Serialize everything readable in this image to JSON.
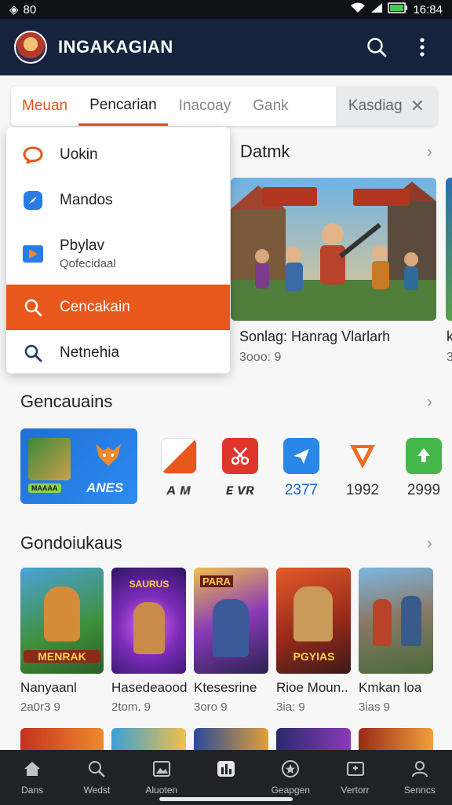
{
  "status": {
    "left": "80",
    "time": "16:84"
  },
  "app": {
    "title": "INGAKAGIAN"
  },
  "tabs": [
    {
      "label": "Meuan"
    },
    {
      "label": "Pencarian"
    },
    {
      "label": "Inacoay"
    },
    {
      "label": "Gank"
    },
    {
      "label": "Kasdiag"
    }
  ],
  "dropdown": [
    {
      "label": "Uokin",
      "icon": "chat-bubble-icon"
    },
    {
      "label": "Mandos",
      "icon": "compass-icon"
    },
    {
      "label": "Pbylav",
      "sub": "Qofecidaal",
      "icon": "play-icon"
    },
    {
      "label": "Cencakain",
      "icon": "search-icon"
    },
    {
      "label": "Netnehia",
      "icon": "search-icon"
    }
  ],
  "featured": {
    "section": "Datmk",
    "title": "Sonlag: Hanrag Vlarlarh",
    "meta": "3ooo: 9",
    "peek_title": "k",
    "peek_meta": "3"
  },
  "categories": {
    "section": "Gencauains",
    "banner_label": "ANES",
    "banner_sign": "MAAAA",
    "items": [
      {
        "label": "ᴀ ᴍ",
        "color": "#333333"
      },
      {
        "label": "ᴇ ᴠʀ",
        "color": "#333333"
      },
      {
        "label": "2377",
        "color": "#1f66c9"
      },
      {
        "label": "1992",
        "color": "#333333"
      },
      {
        "label": "2999",
        "color": "#333333"
      }
    ]
  },
  "games": {
    "section": "Gondoiukaus",
    "items": [
      {
        "name": "Nanyaanl",
        "meta": "2a0r3 9",
        "cover_text": "MENRAK"
      },
      {
        "name": "Hasedeaood",
        "meta": "2tom. 9",
        "cover_text": "SAURUS"
      },
      {
        "name": "Ktesesrine",
        "meta": "3oro 9",
        "cover_text": "PARA"
      },
      {
        "name": "Rioe Moun..",
        "meta": "3ia: 9",
        "cover_text": "PGYIAS"
      },
      {
        "name": "Kmkan loa",
        "meta": "3ias 9",
        "cover_text": ""
      }
    ]
  },
  "nav": [
    {
      "label": "Dans",
      "icon": "home-icon"
    },
    {
      "label": "Wedst",
      "icon": "search-icon"
    },
    {
      "label": "Aluoten",
      "icon": "image-icon"
    },
    {
      "label": "",
      "icon": "chart-icon"
    },
    {
      "label": "Geapgen",
      "icon": "star-circle-icon"
    },
    {
      "label": "Vertorr",
      "icon": "mail-icon"
    },
    {
      "label": "Senncs",
      "icon": "user-icon"
    }
  ]
}
